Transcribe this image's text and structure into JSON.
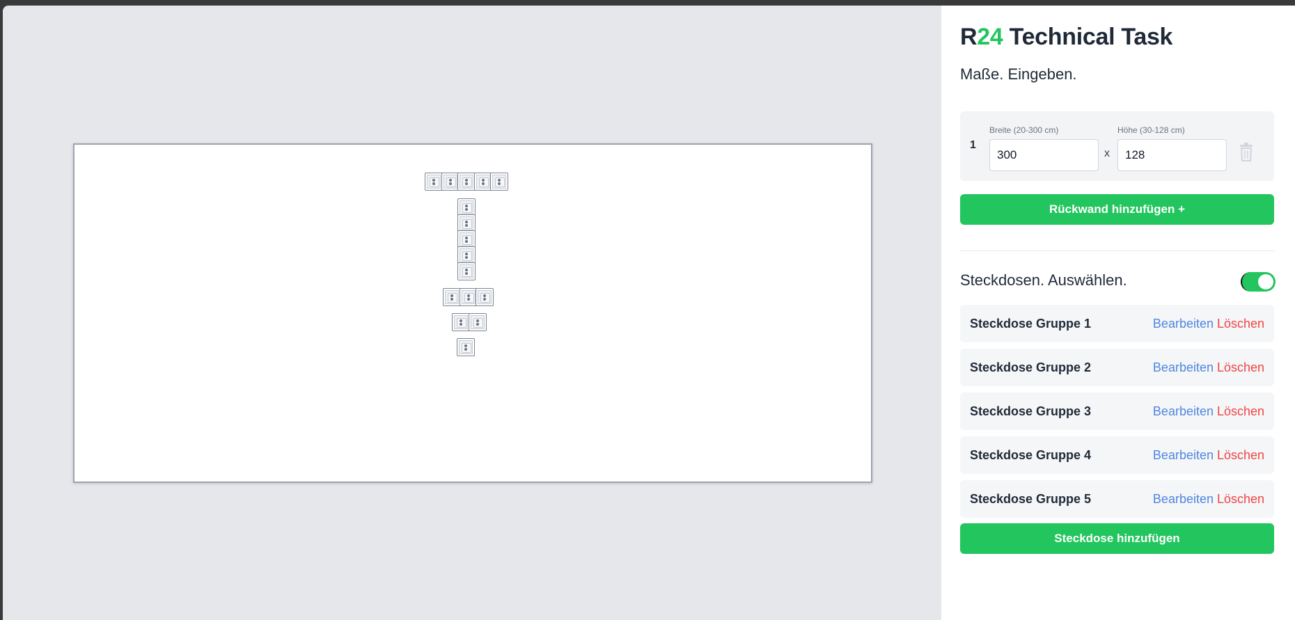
{
  "app": {
    "title_prefix": "R",
    "title_accent": "24",
    "title_suffix": " Technical Task"
  },
  "dimensions": {
    "section_title": "Maße. Eingeben.",
    "rows": [
      {
        "index": "1",
        "width_label": "Breite (20-300 cm)",
        "width_value": "300",
        "times": "x",
        "height_label": "Höhe (30-128 cm)",
        "height_value": "128"
      }
    ],
    "add_button": "Rückwand hinzufügen +"
  },
  "sockets": {
    "section_title": "Steckdosen. Auswählen.",
    "toggle_on": true,
    "groups": [
      {
        "name": "Steckdose Gruppe 1",
        "edit": "Bearbeiten",
        "delete": "Löschen"
      },
      {
        "name": "Steckdose Gruppe 2",
        "edit": "Bearbeiten",
        "delete": "Löschen"
      },
      {
        "name": "Steckdose Gruppe 3",
        "edit": "Bearbeiten",
        "delete": "Löschen"
      },
      {
        "name": "Steckdose Gruppe 4",
        "edit": "Bearbeiten",
        "delete": "Löschen"
      },
      {
        "name": "Steckdose Gruppe 5",
        "edit": "Bearbeiten",
        "delete": "Löschen"
      }
    ],
    "add_button": "Steckdose hinzufügen"
  },
  "wall_preview": {
    "groups": [
      {
        "orientation": "horizontal",
        "count": 5
      },
      {
        "orientation": "vertical",
        "count": 5
      },
      {
        "orientation": "horizontal",
        "count": 3
      },
      {
        "orientation": "horizontal",
        "count": 2
      },
      {
        "orientation": "horizontal",
        "count": 1
      }
    ]
  },
  "colors": {
    "accent": "#22c55e",
    "edit": "#4f86e0",
    "delete": "#ef4444"
  }
}
